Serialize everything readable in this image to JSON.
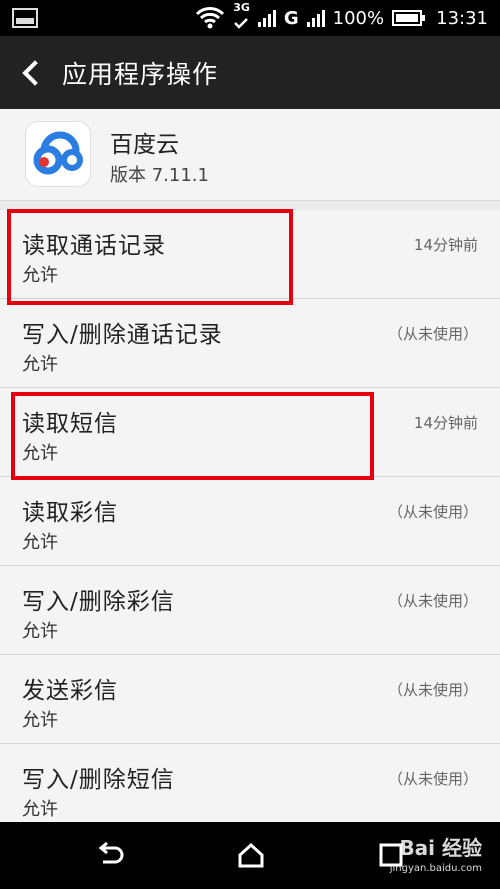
{
  "status_bar": {
    "network_type": "3G",
    "network_g": "G",
    "battery": "100%",
    "time": "13:31"
  },
  "action_bar": {
    "title": "应用程序操作"
  },
  "app": {
    "name": "百度云",
    "version": "版本 7.11.1"
  },
  "permissions": [
    {
      "title": "读取通话记录",
      "status": "允许",
      "last_used": "14分钟前",
      "highlighted": true
    },
    {
      "title": "写入/删除通话记录",
      "status": "允许",
      "last_used": "（从未使用）",
      "highlighted": false
    },
    {
      "title": "读取短信",
      "status": "允许",
      "last_used": "14分钟前",
      "highlighted": true
    },
    {
      "title": "读取彩信",
      "status": "允许",
      "last_used": "（从未使用）",
      "highlighted": false
    },
    {
      "title": "写入/删除彩信",
      "status": "允许",
      "last_used": "（从未使用）",
      "highlighted": false
    },
    {
      "title": "发送彩信",
      "status": "允许",
      "last_used": "（从未使用）",
      "highlighted": false
    },
    {
      "title": "写入/删除短信",
      "status": "允许",
      "last_used": "（从未使用）",
      "highlighted": false
    }
  ],
  "watermark": {
    "brand": "Bai 经验",
    "url": "jingyan.baidu.com"
  },
  "colors": {
    "highlight": "#e5000f",
    "action_bar": "#222222",
    "app_icon_blue": "#2a7de1",
    "app_icon_red": "#e8342f"
  }
}
